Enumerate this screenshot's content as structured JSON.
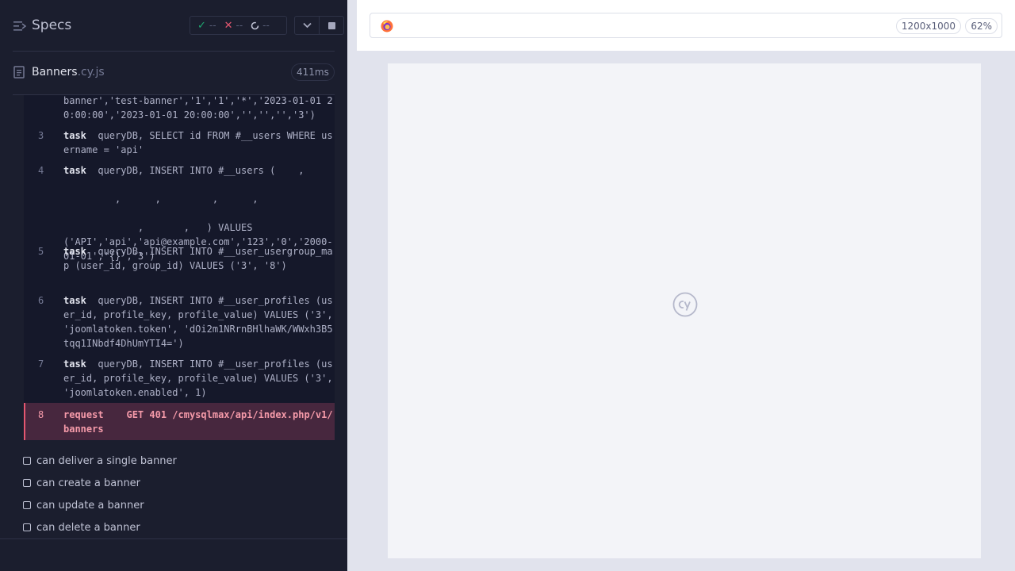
{
  "reporter": {
    "title": "Specs",
    "stats": {
      "passed": "--",
      "failed": "--",
      "pending": "--"
    },
    "spec": {
      "name": "Banners",
      "ext": ".cy.js",
      "duration": "411ms"
    },
    "commands": [
      {
        "num": "",
        "kw": "",
        "text": "banner','test-banner','1','1','*','2023-01-01 20:00:00','2023-01-01 20:00:00','','','','3')"
      },
      {
        "num": "3",
        "kw": "task",
        "text": "queryDB, SELECT id FROM #__users WHERE username = 'api'"
      },
      {
        "num": "4",
        "kw": "task",
        "text": "queryDB, INSERT INTO #__users (    ,\n\n         ,      ,         ,      ,\n\n             ,       ,   ) VALUES\n('API','api','api@example.com','123','0','2000-01-01','{}','3')"
      },
      {
        "num": "5",
        "kw": "task",
        "text": "queryDB, INSERT INTO #__user_usergroup_map (user_id, group_id) VALUES ('3', '8')"
      },
      {
        "num": "6",
        "kw": "task",
        "text": "queryDB, INSERT INTO #__user_profiles (user_id, profile_key, profile_value) VALUES ('3', 'joomlatoken.token', 'dOi2m1NRrnBHlhaWK/WWxh3B5tqq1INbdf4DhUmYTI4=')"
      },
      {
        "num": "7",
        "kw": "task",
        "text": "queryDB, INSERT INTO #__user_profiles (user_id, profile_key, profile_value) VALUES ('3', 'joomlatoken.enabled', 1)"
      },
      {
        "num": "8",
        "kw": "request",
        "text": "GET 401 /cmysqlmax/api/index.php/v1/banners"
      }
    ],
    "tests": [
      "can deliver a single banner",
      "can create a banner",
      "can update a banner",
      "can delete a banner"
    ]
  },
  "aut": {
    "viewport_size": "1200x1000",
    "zoom": "62%"
  },
  "colors": {
    "reporter_bg": "#1b1e2e",
    "log_bg": "#15182a",
    "fail_accent": "#e45770",
    "pass_accent": "#1fa971"
  }
}
